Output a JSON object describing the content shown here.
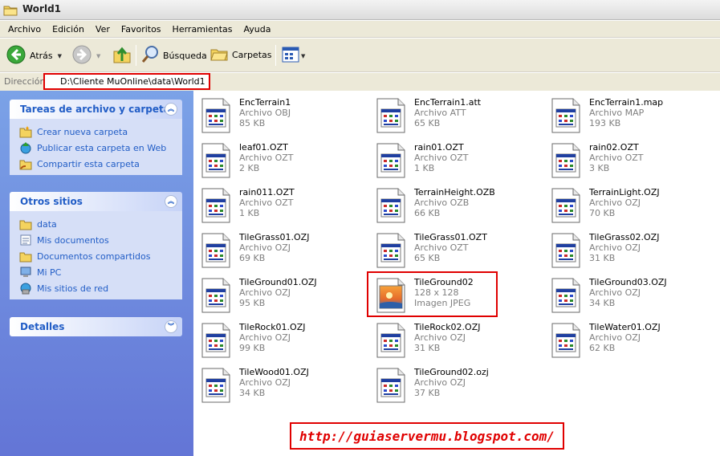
{
  "window": {
    "title": "World1"
  },
  "menu": [
    "Archivo",
    "Edición",
    "Ver",
    "Favoritos",
    "Herramientas",
    "Ayuda"
  ],
  "toolbar": {
    "back": "Atrás",
    "search": "Búsqueda",
    "folders": "Carpetas"
  },
  "address": {
    "label": "Dirección",
    "path": "D:\\Cliente MuOnline\\data\\World1"
  },
  "panels": {
    "tasks": {
      "title": "Tareas de archivo y carpeta",
      "items": [
        "Crear nueva carpeta",
        "Publicar esta carpeta en Web",
        "Compartir esta carpeta"
      ]
    },
    "places": {
      "title": "Otros sitios",
      "items": [
        "data",
        "Mis documentos",
        "Documentos compartidos",
        "Mi PC",
        "Mis sitios de red"
      ]
    },
    "details": {
      "title": "Detalles"
    }
  },
  "files": [
    {
      "name": "EncTerrain1",
      "type": "Archivo OBJ",
      "size": "85 KB",
      "icon": "generic-file-icon"
    },
    {
      "name": "EncTerrain1.att",
      "type": "Archivo ATT",
      "size": "65 KB",
      "icon": "generic-file-icon"
    },
    {
      "name": "EncTerrain1.map",
      "type": "Archivo MAP",
      "size": "193 KB",
      "icon": "generic-file-icon"
    },
    {
      "name": "leaf01.OZT",
      "type": "Archivo OZT",
      "size": "2 KB",
      "icon": "generic-file-icon"
    },
    {
      "name": "rain01.OZT",
      "type": "Archivo OZT",
      "size": "1 KB",
      "icon": "generic-file-icon"
    },
    {
      "name": "rain02.OZT",
      "type": "Archivo OZT",
      "size": "3 KB",
      "icon": "generic-file-icon"
    },
    {
      "name": "rain011.OZT",
      "type": "Archivo OZT",
      "size": "1 KB",
      "icon": "generic-file-icon"
    },
    {
      "name": "TerrainHeight.OZB",
      "type": "Archivo OZB",
      "size": "66 KB",
      "icon": "generic-file-icon"
    },
    {
      "name": "TerrainLight.OZJ",
      "type": "Archivo OZJ",
      "size": "70 KB",
      "icon": "generic-file-icon"
    },
    {
      "name": "TileGrass01.OZJ",
      "type": "Archivo OZJ",
      "size": "69 KB",
      "icon": "generic-file-icon"
    },
    {
      "name": "TileGrass01.OZT",
      "type": "Archivo OZT",
      "size": "65 KB",
      "icon": "generic-file-icon"
    },
    {
      "name": "TileGrass02.OZJ",
      "type": "Archivo OZJ",
      "size": "31 KB",
      "icon": "generic-file-icon"
    },
    {
      "name": "TileGround01.OZJ",
      "type": "Archivo OZJ",
      "size": "95 KB",
      "icon": "generic-file-icon"
    },
    {
      "name": "TileGround02",
      "type": "128 x 128",
      "size": "Imagen JPEG",
      "icon": "jpeg-image-icon"
    },
    {
      "name": "TileGround03.OZJ",
      "type": "Archivo OZJ",
      "size": "34 KB",
      "icon": "generic-file-icon"
    },
    {
      "name": "TileRock01.OZJ",
      "type": "Archivo OZJ",
      "size": "99 KB",
      "icon": "generic-file-icon"
    },
    {
      "name": "TileRock02.OZJ",
      "type": "Archivo OZJ",
      "size": "31 KB",
      "icon": "generic-file-icon"
    },
    {
      "name": "TileWater01.OZJ",
      "type": "Archivo OZJ",
      "size": "62 KB",
      "icon": "generic-file-icon"
    },
    {
      "name": "TileWood01.OZJ",
      "type": "Archivo OZJ",
      "size": "34 KB",
      "icon": "generic-file-icon"
    },
    {
      "name": "TileGround02.ozj",
      "type": "Archivo OZJ",
      "size": "37 KB",
      "icon": "generic-file-icon"
    }
  ],
  "watermark": {
    "url": "http://guiaservermu.blogspot.com/"
  },
  "colors": {
    "highlight": "#e00000",
    "taskpane": "#6f8ee0",
    "link": "#215dc6"
  }
}
